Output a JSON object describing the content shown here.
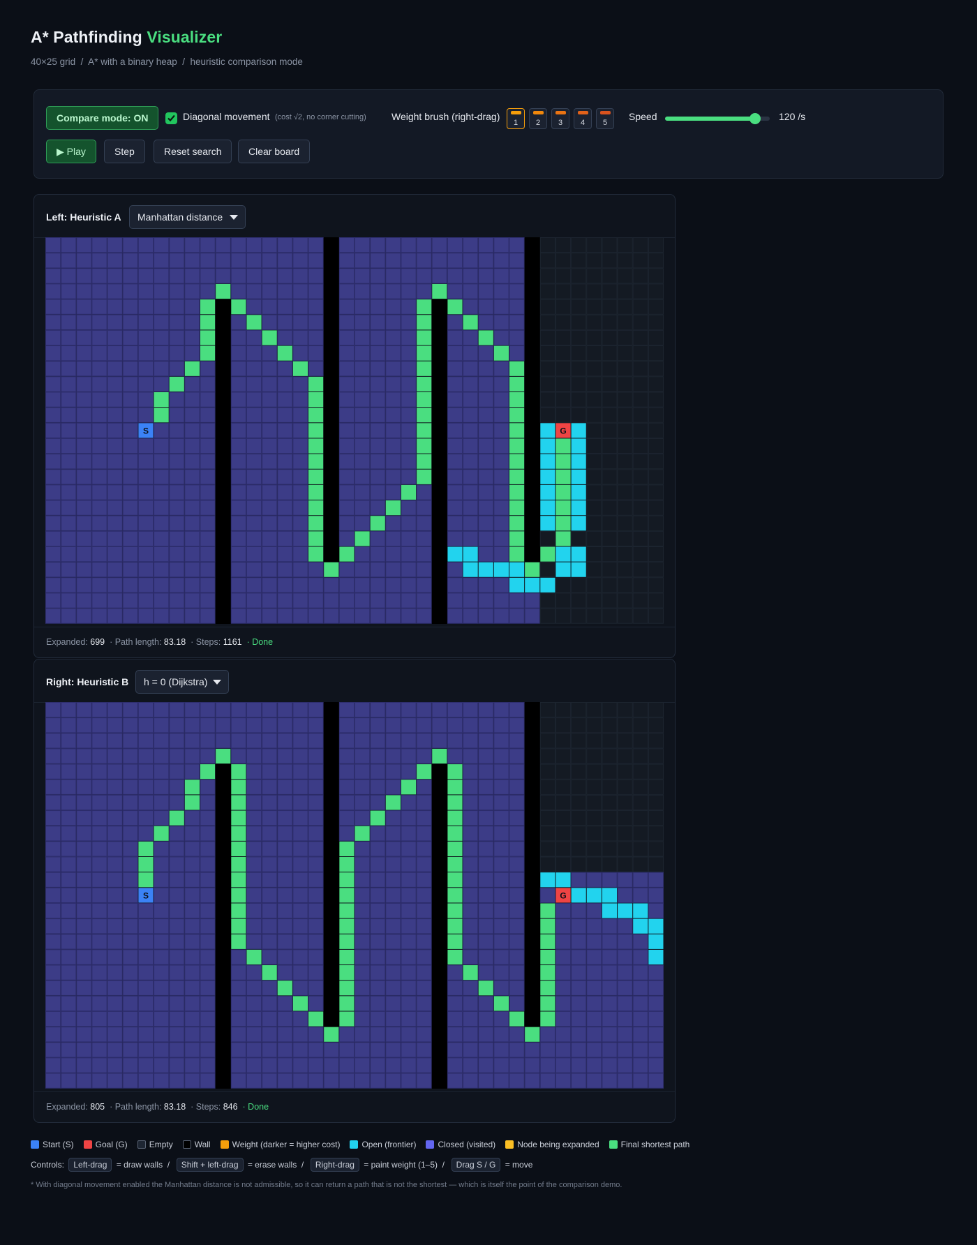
{
  "header": {
    "title_main": "A* Pathfinding",
    "title_accent": "Visualizer",
    "subtitle": "40×25 grid  /  A* with a binary heap  /  heuristic comparison mode"
  },
  "toolbar": {
    "compare_label": "Compare mode: ON",
    "diagonal_label": "Diagonal movement",
    "diagonal_checked": true,
    "diagonal_note": "(cost √2, no corner cutting)",
    "weight_label": "Weight brush (right-drag)",
    "weights": [
      {
        "label": "1",
        "color": "#f59e0b"
      },
      {
        "label": "2",
        "color": "#f0880c"
      },
      {
        "label": "3",
        "color": "#ea7413"
      },
      {
        "label": "4",
        "color": "#e2621a"
      },
      {
        "label": "5",
        "color": "#d9531e"
      }
    ],
    "active_weight": "1",
    "speed_label": "Speed",
    "speed_value": 120,
    "speed_max": 140,
    "speed_text": "120 /s",
    "play_label": "▶ Play",
    "step_label": "Step",
    "reset_label": "Reset search",
    "clear_label": "Clear board"
  },
  "colors": {
    "empty": "#141a23",
    "empty_line": "#1c242f",
    "closed": "#3c3c87",
    "closed_line": "#2e2e6e",
    "open": "#22d3ee",
    "path": "#4ade80",
    "wall": "#000000",
    "start": "#3b82f6",
    "goal": "#ef4444"
  },
  "grid": {
    "cols": 40,
    "rows": 25,
    "walls": [
      {
        "col": 11,
        "row_from": 4,
        "row_to": 24
      },
      {
        "col": 18,
        "row_from": 0,
        "row_to": 20
      },
      {
        "col": 25,
        "row_from": 4,
        "row_to": 24
      },
      {
        "col": 31,
        "row_from": 0,
        "row_to": 20
      }
    ],
    "start": {
      "col": 6,
      "row": 12,
      "label": "S"
    },
    "goal": {
      "col": 33,
      "row": 12,
      "label": "G"
    }
  },
  "panels": [
    {
      "title": "Left: Heuristic A",
      "heuristic": "Manhattan distance",
      "expanded_label": "Expanded:",
      "expanded": "699",
      "path_label": "· Path length:",
      "path_length": "83.18",
      "steps_label": "· Steps:",
      "steps": "1161",
      "status": "· Done",
      "closed_rect": {
        "col_to": 31,
        "row_to": 24
      },
      "closed_extra": [
        [
          25,
          15
        ],
        [
          25,
          16
        ],
        [
          25,
          17
        ],
        [
          25,
          18
        ],
        [
          25,
          19
        ],
        [
          25,
          20
        ],
        [
          25,
          21
        ],
        [
          25,
          22
        ],
        [
          25,
          23
        ],
        [
          25,
          24
        ],
        [
          26,
          18
        ],
        [
          27,
          18
        ],
        [
          28,
          18
        ],
        [
          29,
          18
        ],
        [
          30,
          18
        ],
        [
          31,
          18
        ]
      ],
      "open": [
        [
          32,
          12
        ],
        [
          32,
          13
        ],
        [
          32,
          14
        ],
        [
          32,
          15
        ],
        [
          32,
          16
        ],
        [
          32,
          17
        ],
        [
          32,
          18
        ],
        [
          34,
          12
        ],
        [
          34,
          13
        ],
        [
          34,
          14
        ],
        [
          34,
          15
        ],
        [
          34,
          16
        ],
        [
          34,
          17
        ],
        [
          34,
          18
        ],
        [
          26,
          20
        ],
        [
          27,
          20
        ],
        [
          27,
          21
        ],
        [
          28,
          21
        ],
        [
          29,
          21
        ],
        [
          30,
          21
        ],
        [
          31,
          21
        ],
        [
          33,
          21
        ],
        [
          34,
          21
        ],
        [
          30,
          22
        ],
        [
          31,
          22
        ],
        [
          32,
          22
        ],
        [
          32,
          20
        ],
        [
          33,
          20
        ],
        [
          34,
          20
        ]
      ],
      "path": [
        [
          6,
          12
        ],
        [
          7,
          11
        ],
        [
          7,
          10
        ],
        [
          8,
          9
        ],
        [
          9,
          8
        ],
        [
          10,
          7
        ],
        [
          10,
          6
        ],
        [
          10,
          5
        ],
        [
          10,
          4
        ],
        [
          11,
          3
        ],
        [
          12,
          4
        ],
        [
          13,
          5
        ],
        [
          14,
          6
        ],
        [
          15,
          7
        ],
        [
          16,
          8
        ],
        [
          17,
          9
        ],
        [
          17,
          10
        ],
        [
          17,
          11
        ],
        [
          17,
          12
        ],
        [
          17,
          13
        ],
        [
          17,
          14
        ],
        [
          17,
          15
        ],
        [
          17,
          16
        ],
        [
          17,
          17
        ],
        [
          17,
          18
        ],
        [
          17,
          19
        ],
        [
          17,
          20
        ],
        [
          18,
          21
        ],
        [
          19,
          20
        ],
        [
          20,
          19
        ],
        [
          21,
          18
        ],
        [
          22,
          17
        ],
        [
          23,
          16
        ],
        [
          24,
          15
        ],
        [
          24,
          14
        ],
        [
          24,
          13
        ],
        [
          24,
          12
        ],
        [
          24,
          11
        ],
        [
          24,
          10
        ],
        [
          24,
          9
        ],
        [
          24,
          8
        ],
        [
          24,
          7
        ],
        [
          24,
          6
        ],
        [
          24,
          5
        ],
        [
          24,
          4
        ],
        [
          25,
          3
        ],
        [
          26,
          4
        ],
        [
          27,
          5
        ],
        [
          28,
          6
        ],
        [
          29,
          7
        ],
        [
          30,
          8
        ],
        [
          30,
          9
        ],
        [
          30,
          10
        ],
        [
          30,
          11
        ],
        [
          30,
          12
        ],
        [
          30,
          13
        ],
        [
          30,
          14
        ],
        [
          30,
          15
        ],
        [
          30,
          16
        ],
        [
          30,
          17
        ],
        [
          30,
          18
        ],
        [
          30,
          19
        ],
        [
          30,
          20
        ],
        [
          31,
          21
        ],
        [
          32,
          20
        ],
        [
          33,
          13
        ],
        [
          33,
          14
        ],
        [
          33,
          15
        ],
        [
          33,
          16
        ],
        [
          33,
          17
        ],
        [
          33,
          18
        ],
        [
          33,
          19
        ]
      ]
    },
    {
      "title": "Right: Heuristic B",
      "heuristic": "h = 0 (Dijkstra)",
      "expanded_label": "Expanded:",
      "expanded": "805",
      "path_label": "· Path length:",
      "path_length": "83.18",
      "steps_label": "· Steps:",
      "steps": "846",
      "status": "· Done",
      "closed_rect": {
        "col_to": 39,
        "row_to": 24
      },
      "closed_hole": {
        "col_from": 32,
        "col_to": 39,
        "row_from": 0,
        "row_to": 10
      },
      "closed_extra": [],
      "open": [
        [
          32,
          11
        ],
        [
          33,
          11
        ],
        [
          34,
          12
        ],
        [
          35,
          12
        ],
        [
          36,
          12
        ],
        [
          36,
          13
        ],
        [
          37,
          13
        ],
        [
          38,
          13
        ],
        [
          38,
          14
        ],
        [
          39,
          14
        ],
        [
          39,
          15
        ],
        [
          39,
          16
        ]
      ],
      "path": [
        [
          6,
          12
        ],
        [
          6,
          11
        ],
        [
          6,
          10
        ],
        [
          6,
          9
        ],
        [
          7,
          8
        ],
        [
          8,
          7
        ],
        [
          9,
          6
        ],
        [
          9,
          5
        ],
        [
          10,
          4
        ],
        [
          11,
          3
        ],
        [
          12,
          4
        ],
        [
          12,
          5
        ],
        [
          12,
          6
        ],
        [
          12,
          7
        ],
        [
          12,
          8
        ],
        [
          12,
          9
        ],
        [
          12,
          10
        ],
        [
          12,
          11
        ],
        [
          12,
          12
        ],
        [
          12,
          13
        ],
        [
          12,
          14
        ],
        [
          12,
          15
        ],
        [
          13,
          16
        ],
        [
          14,
          17
        ],
        [
          15,
          18
        ],
        [
          16,
          19
        ],
        [
          17,
          20
        ],
        [
          18,
          21
        ],
        [
          19,
          20
        ],
        [
          19,
          19
        ],
        [
          19,
          18
        ],
        [
          19,
          17
        ],
        [
          19,
          16
        ],
        [
          19,
          15
        ],
        [
          19,
          14
        ],
        [
          19,
          13
        ],
        [
          19,
          12
        ],
        [
          19,
          11
        ],
        [
          19,
          10
        ],
        [
          19,
          9
        ],
        [
          20,
          8
        ],
        [
          21,
          7
        ],
        [
          22,
          6
        ],
        [
          23,
          5
        ],
        [
          24,
          4
        ],
        [
          25,
          3
        ],
        [
          26,
          4
        ],
        [
          26,
          5
        ],
        [
          26,
          6
        ],
        [
          26,
          7
        ],
        [
          26,
          8
        ],
        [
          26,
          9
        ],
        [
          26,
          10
        ],
        [
          26,
          11
        ],
        [
          26,
          12
        ],
        [
          26,
          13
        ],
        [
          26,
          14
        ],
        [
          26,
          15
        ],
        [
          26,
          16
        ],
        [
          27,
          17
        ],
        [
          28,
          18
        ],
        [
          29,
          19
        ],
        [
          30,
          20
        ],
        [
          31,
          21
        ],
        [
          32,
          20
        ],
        [
          32,
          19
        ],
        [
          32,
          18
        ],
        [
          32,
          17
        ],
        [
          32,
          16
        ],
        [
          32,
          15
        ],
        [
          32,
          14
        ],
        [
          32,
          13
        ]
      ]
    }
  ],
  "legend": [
    {
      "label": "Start (S)",
      "color": "#3b82f6"
    },
    {
      "label": "Goal (G)",
      "color": "#ef4444"
    },
    {
      "label": "Empty",
      "color": "#1e2633"
    },
    {
      "label": "Wall",
      "color": "#000000"
    },
    {
      "label": "Weight (darker = higher cost)",
      "color": "#f59e0b"
    },
    {
      "label": "Open (frontier)",
      "color": "#22d3ee"
    },
    {
      "label": "Closed (visited)",
      "color": "#6366f1"
    },
    {
      "label": "Node being expanded",
      "color": "#fbbf24"
    },
    {
      "label": "Final shortest path",
      "color": "#4ade80"
    }
  ],
  "controls": {
    "prefix": "Controls:",
    "items": [
      {
        "key": "Left-drag",
        "desc": "= draw walls  /"
      },
      {
        "key": "Shift + left-drag",
        "desc": "= erase walls  /"
      },
      {
        "key": "Right-drag",
        "desc": "= paint weight (1–5)  /"
      },
      {
        "key": "Drag S / G",
        "desc": "= move"
      }
    ]
  },
  "footnote": "* With diagonal movement enabled the Manhattan distance is not admissible, so it can return a path that is not the shortest — which is itself the point of the comparison demo."
}
